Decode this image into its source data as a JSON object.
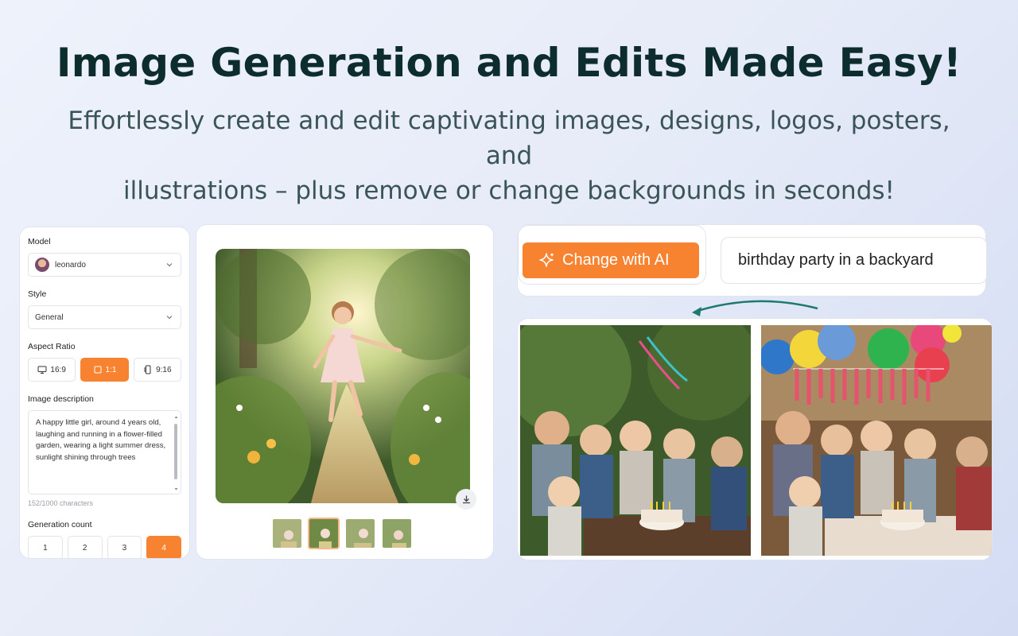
{
  "hero": {
    "title": "Image Generation and Edits Made Easy!",
    "subtitle_line1": "Effortlessly create and edit captivating images, designs, logos, posters, and",
    "subtitle_line2": "illustrations – plus remove or change backgrounds in seconds!"
  },
  "panel": {
    "model_label": "Model",
    "model_value": "leonardo",
    "style_label": "Style",
    "style_value": "General",
    "aspect_label": "Aspect Ratio",
    "aspect_options": [
      "16:9",
      "1:1",
      "9:16"
    ],
    "aspect_selected": "1:1",
    "description_label": "Image description",
    "description_text": "A happy little girl, around 4 years old, laughing and running in a flower-filled garden, wearing a light summer dress, sunlight shining through trees",
    "char_count": "152/1000 characters",
    "generation_label": "Generation count",
    "generation_options": [
      "1",
      "2",
      "3",
      "4"
    ],
    "generation_selected": "4"
  },
  "editor": {
    "change_button": "Change with AI",
    "prompt": "birthday party in a backyard"
  },
  "colors": {
    "accent": "#f7822f",
    "title": "#0c2c2e",
    "arrow": "#1e7a6f"
  }
}
